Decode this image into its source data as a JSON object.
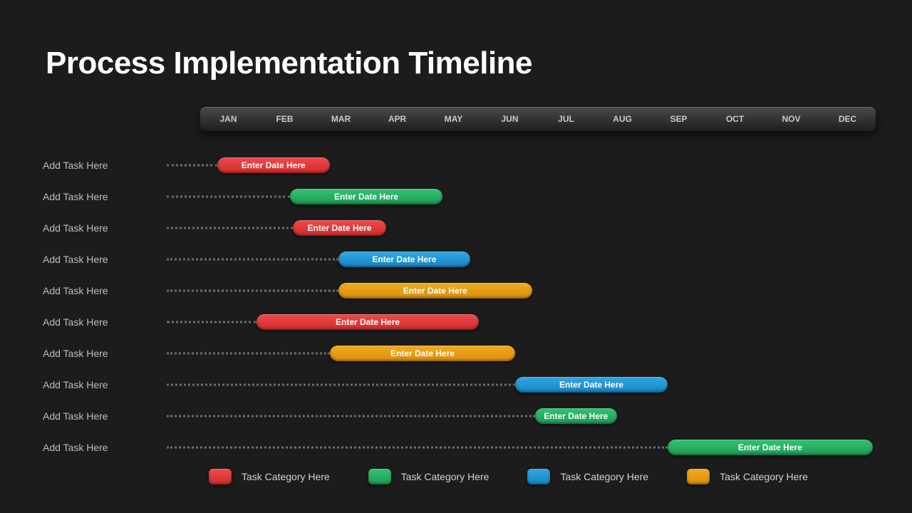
{
  "title": "Process Implementation Timeline",
  "months": [
    "JAN",
    "FEB",
    "MAR",
    "APR",
    "MAY",
    "JUN",
    "JUL",
    "AUG",
    "SEP",
    "OCT",
    "NOV",
    "DEC"
  ],
  "tasks": [
    {
      "label": "Add Task Here",
      "bar_label": "Enter Date Here",
      "category": "red"
    },
    {
      "label": "Add Task Here",
      "bar_label": "Enter Date Here",
      "category": "green"
    },
    {
      "label": "Add Task Here",
      "bar_label": "Enter Date Here",
      "category": "red"
    },
    {
      "label": "Add Task Here",
      "bar_label": "Enter Date Here",
      "category": "blue"
    },
    {
      "label": "Add Task Here",
      "bar_label": "Enter Date Here",
      "category": "orange"
    },
    {
      "label": "Add Task Here",
      "bar_label": "Enter Date Here",
      "category": "red"
    },
    {
      "label": "Add Task Here",
      "bar_label": "Enter Date Here",
      "category": "orange"
    },
    {
      "label": "Add Task Here",
      "bar_label": "Enter Date Here",
      "category": "blue"
    },
    {
      "label": "Add Task Here",
      "bar_label": "Enter Date Here",
      "category": "green"
    },
    {
      "label": "Add Task Here",
      "bar_label": "Enter Date Here",
      "category": "green"
    }
  ],
  "legend": [
    {
      "color": "red",
      "label": "Task Category Here"
    },
    {
      "color": "green",
      "label": "Task Category Here"
    },
    {
      "color": "blue",
      "label": "Task Category Here"
    },
    {
      "color": "orange",
      "label": "Task Category Here"
    }
  ],
  "colors": {
    "red": "linear-gradient(#ef4b4b,#d22b2b)",
    "green": "linear-gradient(#31c471,#1f9a56)",
    "blue": "linear-gradient(#2fa8e6,#1b84c2)",
    "orange": "linear-gradient(#f2ab1f,#d98f0b)"
  },
  "chart_data": {
    "type": "bar",
    "title": "Process Implementation Timeline",
    "xlabel": "",
    "ylabel": "",
    "categories": [
      "JAN",
      "FEB",
      "MAR",
      "APR",
      "MAY",
      "JUN",
      "JUL",
      "AUG",
      "SEP",
      "OCT",
      "NOV",
      "DEC"
    ],
    "xlim": [
      0,
      12
    ],
    "series": [
      {
        "name": "Add Task Here",
        "category": "red",
        "start": 0.3,
        "end": 2.3,
        "label": "Enter Date Here"
      },
      {
        "name": "Add Task Here",
        "category": "green",
        "start": 1.6,
        "end": 4.3,
        "label": "Enter Date Here"
      },
      {
        "name": "Add Task Here",
        "category": "red",
        "start": 1.65,
        "end": 3.3,
        "label": "Enter Date Here"
      },
      {
        "name": "Add Task Here",
        "category": "blue",
        "start": 2.45,
        "end": 4.8,
        "label": "Enter Date Here"
      },
      {
        "name": "Add Task Here",
        "category": "orange",
        "start": 2.45,
        "end": 5.9,
        "label": "Enter Date Here"
      },
      {
        "name": "Add Task Here",
        "category": "red",
        "start": 1.0,
        "end": 4.95,
        "label": "Enter Date Here"
      },
      {
        "name": "Add Task Here",
        "category": "orange",
        "start": 2.3,
        "end": 5.6,
        "label": "Enter Date Here"
      },
      {
        "name": "Add Task Here",
        "category": "blue",
        "start": 5.6,
        "end": 8.3,
        "label": "Enter Date Here"
      },
      {
        "name": "Add Task Here",
        "category": "green",
        "start": 5.95,
        "end": 7.4,
        "label": "Enter Date Here"
      },
      {
        "name": "Add Task Here",
        "category": "green",
        "start": 8.3,
        "end": 11.95,
        "label": "Enter Date Here"
      }
    ],
    "legend": [
      "Task Category Here",
      "Task Category Here",
      "Task Category Here",
      "Task Category Here"
    ]
  }
}
